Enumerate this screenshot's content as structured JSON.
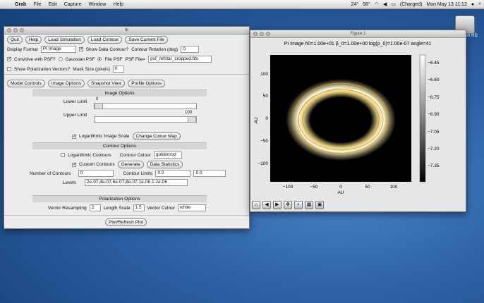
{
  "menubar": {
    "app": "Grab",
    "items": [
      "File",
      "Edit",
      "Capture",
      "Window",
      "Help"
    ],
    "status": {
      "temp1": "24°",
      "temp2": "58°",
      "battery": "(Charged)",
      "datetime": "Mon May 13  11:12"
    }
  },
  "desktop": {
    "hd_label": "Macintosh HD"
  },
  "controls": {
    "title": "tk",
    "buttons": {
      "quit": "Quit",
      "help": "Help",
      "load_sim": "Load Simulation",
      "load_contour": "Load Contour",
      "save_file": "Save Current File"
    },
    "display_format_label": "Display Format",
    "display_format_value": "PI Image",
    "show_contour_label": "Show Data Contour?",
    "contour_rotation_label": "Contour Rotation (deg)",
    "contour_rotation_value": "0",
    "convolve_label": "Convolve with PSF?",
    "gaussian_psf_label": "Gaussian PSF",
    "file_psf_label": "File PSF",
    "psf_file_label": "PSF File=",
    "psf_file_value": "psf_refstar_cropped.fits",
    "show_pol_label": "Show Polarization Vectors?",
    "mask_size_label": "Mask Size (pixels)",
    "mask_size_value": "0",
    "tabs": {
      "model": "Model Controls",
      "image": "Image Options",
      "snapshot": "Snapshot View",
      "profile": "Profile Options"
    },
    "image_options": {
      "header": "Image Options",
      "lower_label": "Lower Limit",
      "lower_value": "0",
      "upper_label": "Upper Limit",
      "upper_value": "100",
      "log_scale_label": "Logarithmic Image Scale",
      "colour_map_button": "Change Colour Map"
    },
    "contour_options": {
      "header": "Contour Options",
      "log_contours_label": "Logarithmic Contours",
      "contour_colour_label": "Contour Colour",
      "contour_colour_value": "goldenrod",
      "custom_contours_label": "Custom Contours",
      "generate_button": "Generate",
      "data_stats_button": "Data Statistics",
      "num_contours_label": "Number of Contours",
      "num_contours_value": "0",
      "contour_limits_label": "Contour Limits",
      "limit_low": "0.0",
      "limit_high": "0.0",
      "levels_label": "Levels",
      "levels_value": "2e-07,4e-07,6e-07,8e-07,1e-06,1.2e-06"
    },
    "polarization_options": {
      "header": "Polarization Options",
      "vector_resampling_label": "Vector Resampling",
      "vector_resampling_value": "2",
      "length_scale_label": "Length Scale",
      "length_scale_value": "1.5",
      "vector_colour_label": "Vector Colour",
      "vector_colour_value": "white"
    },
    "plot_button": "Plot/Refresh Plot"
  },
  "figure": {
    "window_title": "Figure 1",
    "plot_title": "PI Image   h0=1.00e+01  β_0=1.00e+00  log(ρ_0)=1.00e-07   angle=41",
    "xlabel": "AU",
    "ylabel": "AU",
    "x_ticks": [
      "−100",
      "−50",
      "0",
      "50",
      "100"
    ],
    "y_ticks": [
      "100",
      "50",
      "0",
      "−50",
      "−100"
    ],
    "colorbar_ticks": [
      "−6.45",
      "−6.60",
      "−6.75",
      "−6.90",
      "−7.05",
      "−7.20",
      "−7.35"
    ],
    "toolbar_icons": [
      "home-icon",
      "back-icon",
      "forward-icon",
      "pan-icon",
      "zoom-icon",
      "configure-icon",
      "save-icon"
    ],
    "colors": {
      "contour": "#daa520",
      "ring": "#fff6d0"
    }
  }
}
